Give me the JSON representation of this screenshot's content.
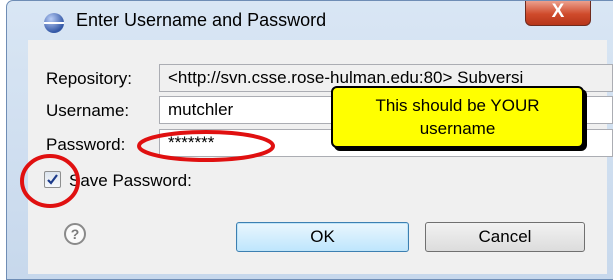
{
  "window": {
    "title": "Enter Username and Password",
    "close_glyph": "X"
  },
  "form": {
    "repository_label": "Repository:",
    "repository_value": "<http://svn.csse.rose-hulman.edu:80> Subversi",
    "username_label": "Username:",
    "username_value": "mutchler",
    "password_label": "Password:",
    "password_value": "*******",
    "save_password_label": "Save Password:",
    "save_password_checked": true
  },
  "buttons": {
    "ok_label": "OK",
    "cancel_label": "Cancel",
    "help_glyph": "?"
  },
  "annotation": {
    "callout_text": "This should be YOUR username",
    "highlight_color": "#e01010",
    "callout_color": "#ffff00"
  },
  "icons": [
    "app-icon",
    "close-icon",
    "checkmark-icon",
    "help-icon"
  ]
}
